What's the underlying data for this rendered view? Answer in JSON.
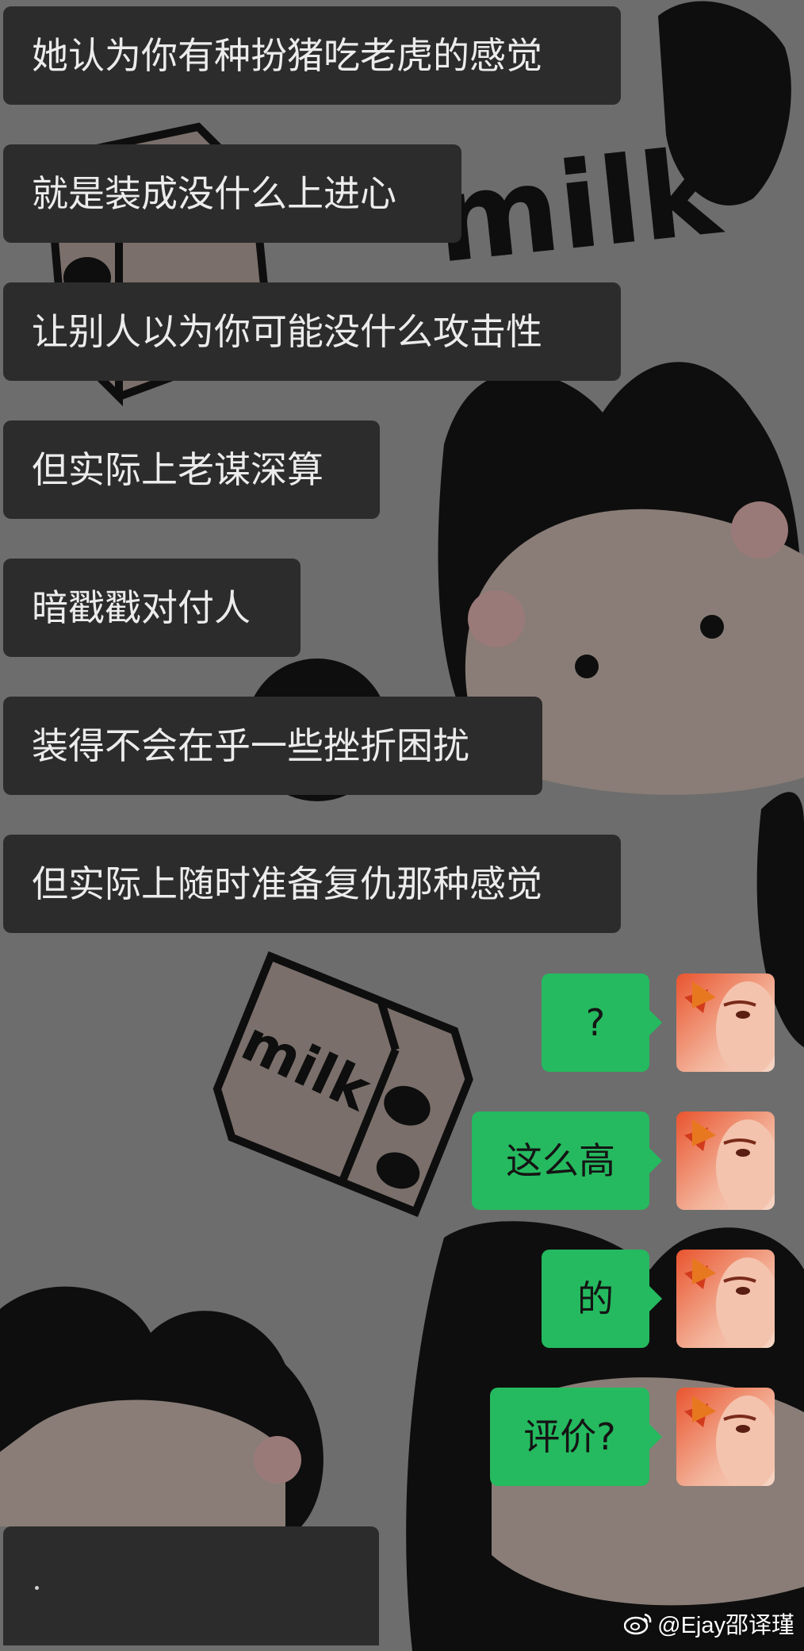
{
  "incoming_messages": [
    "她认为你有种扮猪吃老虎的感觉",
    "就是装成没什么上进心",
    "让别人以为你可能没什么攻击性",
    "但实际上老谋深算",
    "暗戳戳对付人",
    "装得不会在乎一些挫折困扰",
    "但实际上随时准备复仇那种感觉"
  ],
  "outgoing_messages": [
    "?",
    "这么高",
    "的",
    "评价?"
  ],
  "wallpaper": {
    "texts": [
      "milk",
      "milk"
    ]
  },
  "watermark": {
    "handle": "@Ejay邵译瑾",
    "icon": "weibo-icon"
  },
  "colors": {
    "background": "#6d6d6d",
    "incoming_bubble": "#2c2c2c",
    "outgoing_bubble": "#25ba5f"
  }
}
